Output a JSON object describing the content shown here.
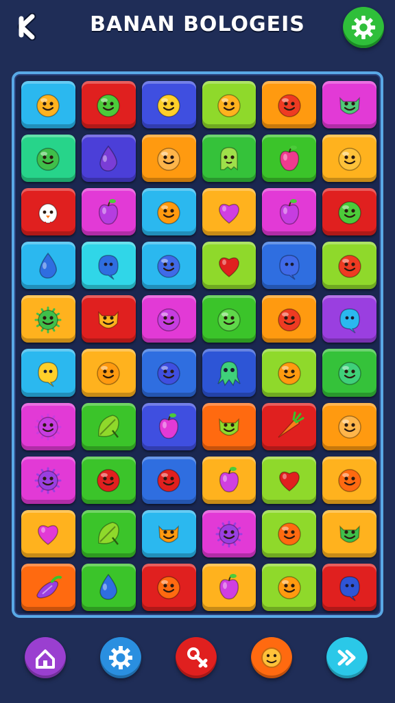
{
  "header": {
    "title": "BANAN BOLOGEIS"
  },
  "icons": {
    "back": "chevron-left-icon",
    "settings": "gear-icon"
  },
  "colors": {
    "background": "#1f2d57",
    "board_border": "#59a8e6",
    "settings_button": "#2fbf3a"
  },
  "board": {
    "rows": [
      [
        {
          "color": "#2bb8ef",
          "face": "smile",
          "fc": "#ffb21e"
        },
        {
          "color": "#e0201f",
          "face": "smile",
          "fc": "#4ccb3a"
        },
        {
          "color": "#3f4fe0",
          "face": "smile",
          "fc": "#ffcf2a"
        },
        {
          "color": "#8fd92b",
          "face": "smile",
          "fc": "#ffb21e"
        },
        {
          "color": "#ff9a10",
          "face": "smile",
          "fc": "#ee3b22"
        },
        {
          "color": "#e23ad6",
          "face": "monster",
          "fc": "#4fc878"
        }
      ],
      [
        {
          "color": "#27d48a",
          "face": "smile",
          "fc": "#3fbf4a"
        },
        {
          "color": "#4b3fd8",
          "face": "drop",
          "fc": "#7a3dd6"
        },
        {
          "color": "#ff9a10",
          "face": "smile",
          "fc": "#ffb54a"
        },
        {
          "color": "#35c23a",
          "face": "ghost",
          "fc": "#9fe04a"
        },
        {
          "color": "#3bc42a",
          "face": "apple",
          "fc": "#ee3b8f"
        },
        {
          "color": "#ffb21e",
          "face": "smile",
          "fc": "#ffc23a"
        }
      ],
      [
        {
          "color": "#e0201f",
          "face": "chick",
          "fc": "#ffffff"
        },
        {
          "color": "#e23ad6",
          "face": "apple",
          "fc": "#b53de0"
        },
        {
          "color": "#2bb8ef",
          "face": "smile",
          "fc": "#ff9a10"
        },
        {
          "color": "#ffb21e",
          "face": "heart",
          "fc": "#d03fe0"
        },
        {
          "color": "#e23ad6",
          "face": "apple",
          "fc": "#c63de0"
        },
        {
          "color": "#e0201f",
          "face": "smile",
          "fc": "#4ccb3a"
        }
      ],
      [
        {
          "color": "#2bb8ef",
          "face": "drop",
          "fc": "#2f6ee0"
        },
        {
          "color": "#30d6e8",
          "face": "blob",
          "fc": "#2f6ee0"
        },
        {
          "color": "#2bb8ef",
          "face": "smile",
          "fc": "#3f6ae8"
        },
        {
          "color": "#8fd92b",
          "face": "heart",
          "fc": "#e0201f"
        },
        {
          "color": "#2f6ee0",
          "face": "blob",
          "fc": "#3f6ae8"
        },
        {
          "color": "#8fd92b",
          "face": "smile",
          "fc": "#ee3b22"
        }
      ],
      [
        {
          "color": "#ffb21e",
          "face": "virus",
          "fc": "#3fbf4a"
        },
        {
          "color": "#e0201f",
          "face": "monster",
          "fc": "#ffb21e"
        },
        {
          "color": "#e23ad6",
          "face": "smile",
          "fc": "#c63de0"
        },
        {
          "color": "#3bc42a",
          "face": "smile",
          "fc": "#5fd84a"
        },
        {
          "color": "#ff9a10",
          "face": "smile",
          "fc": "#ee3b22"
        },
        {
          "color": "#9a3fe0",
          "face": "blob",
          "fc": "#2bb8ef"
        }
      ],
      [
        {
          "color": "#2bb8ef",
          "face": "blob",
          "fc": "#ffcf2a"
        },
        {
          "color": "#ffb21e",
          "face": "smile",
          "fc": "#ff9a10"
        },
        {
          "color": "#2f6ee0",
          "face": "smile",
          "fc": "#3f4fe0"
        },
        {
          "color": "#2d55d6",
          "face": "octo",
          "fc": "#3fd07a"
        },
        {
          "color": "#8fd92b",
          "face": "smile",
          "fc": "#ff9a10"
        },
        {
          "color": "#35c23a",
          "face": "smile",
          "fc": "#3fd07a"
        }
      ],
      [
        {
          "color": "#e23ad6",
          "face": "virus",
          "fc": "#c63de0"
        },
        {
          "color": "#3bc42a",
          "face": "leaf",
          "fc": "#8fd92b"
        },
        {
          "color": "#3f4fe0",
          "face": "apple",
          "fc": "#e23ad6"
        },
        {
          "color": "#ff6a10",
          "face": "monster",
          "fc": "#8fd92b"
        },
        {
          "color": "#e0201f",
          "face": "carrot",
          "fc": "#ff7a1a"
        },
        {
          "color": "#ff9a10",
          "face": "smile",
          "fc": "#ffb54a"
        }
      ],
      [
        {
          "color": "#e23ad6",
          "face": "virus",
          "fc": "#9a3fe0"
        },
        {
          "color": "#3bc42a",
          "face": "smile",
          "fc": "#e0201f"
        },
        {
          "color": "#2f6ee0",
          "face": "smile",
          "fc": "#e0201f"
        },
        {
          "color": "#ffb21e",
          "face": "apple",
          "fc": "#d03fe0"
        },
        {
          "color": "#8fd92b",
          "face": "heart",
          "fc": "#e0201f"
        },
        {
          "color": "#ffb21e",
          "face": "smile",
          "fc": "#ff6a10"
        }
      ],
      [
        {
          "color": "#ffb21e",
          "face": "heart",
          "fc": "#e23ad6"
        },
        {
          "color": "#3bc42a",
          "face": "leaf",
          "fc": "#8fd92b"
        },
        {
          "color": "#2bb8ef",
          "face": "monster",
          "fc": "#ff9a10"
        },
        {
          "color": "#e23ad6",
          "face": "virus",
          "fc": "#9a3fe0"
        },
        {
          "color": "#8fd92b",
          "face": "smile",
          "fc": "#ff6a10"
        },
        {
          "color": "#ffb21e",
          "face": "monster",
          "fc": "#3fbf4a"
        }
      ],
      [
        {
          "color": "#ff6a10",
          "face": "eggplant",
          "fc": "#9a3fe0"
        },
        {
          "color": "#3bc42a",
          "face": "drop",
          "fc": "#2f6ee0"
        },
        {
          "color": "#e0201f",
          "face": "smile",
          "fc": "#ff6a10"
        },
        {
          "color": "#ffb21e",
          "face": "apple",
          "fc": "#d03fe0"
        },
        {
          "color": "#8fd92b",
          "face": "smile",
          "fc": "#ff9a10"
        },
        {
          "color": "#e0201f",
          "face": "blob",
          "fc": "#2f55d6"
        }
      ]
    ]
  },
  "bottom_nav": [
    {
      "name": "home-button",
      "icon": "home-icon",
      "color": "#9a3fd0"
    },
    {
      "name": "options-button",
      "icon": "gear-icon",
      "color": "#2a8fe0"
    },
    {
      "name": "hint-button",
      "icon": "crossed-tool-icon",
      "color": "#e0201f"
    },
    {
      "name": "character-button",
      "icon": "smiley-icon",
      "color": "#ff6a10"
    },
    {
      "name": "fast-forward-button",
      "icon": "fast-forward-icon",
      "color": "#2bc8e8"
    }
  ]
}
